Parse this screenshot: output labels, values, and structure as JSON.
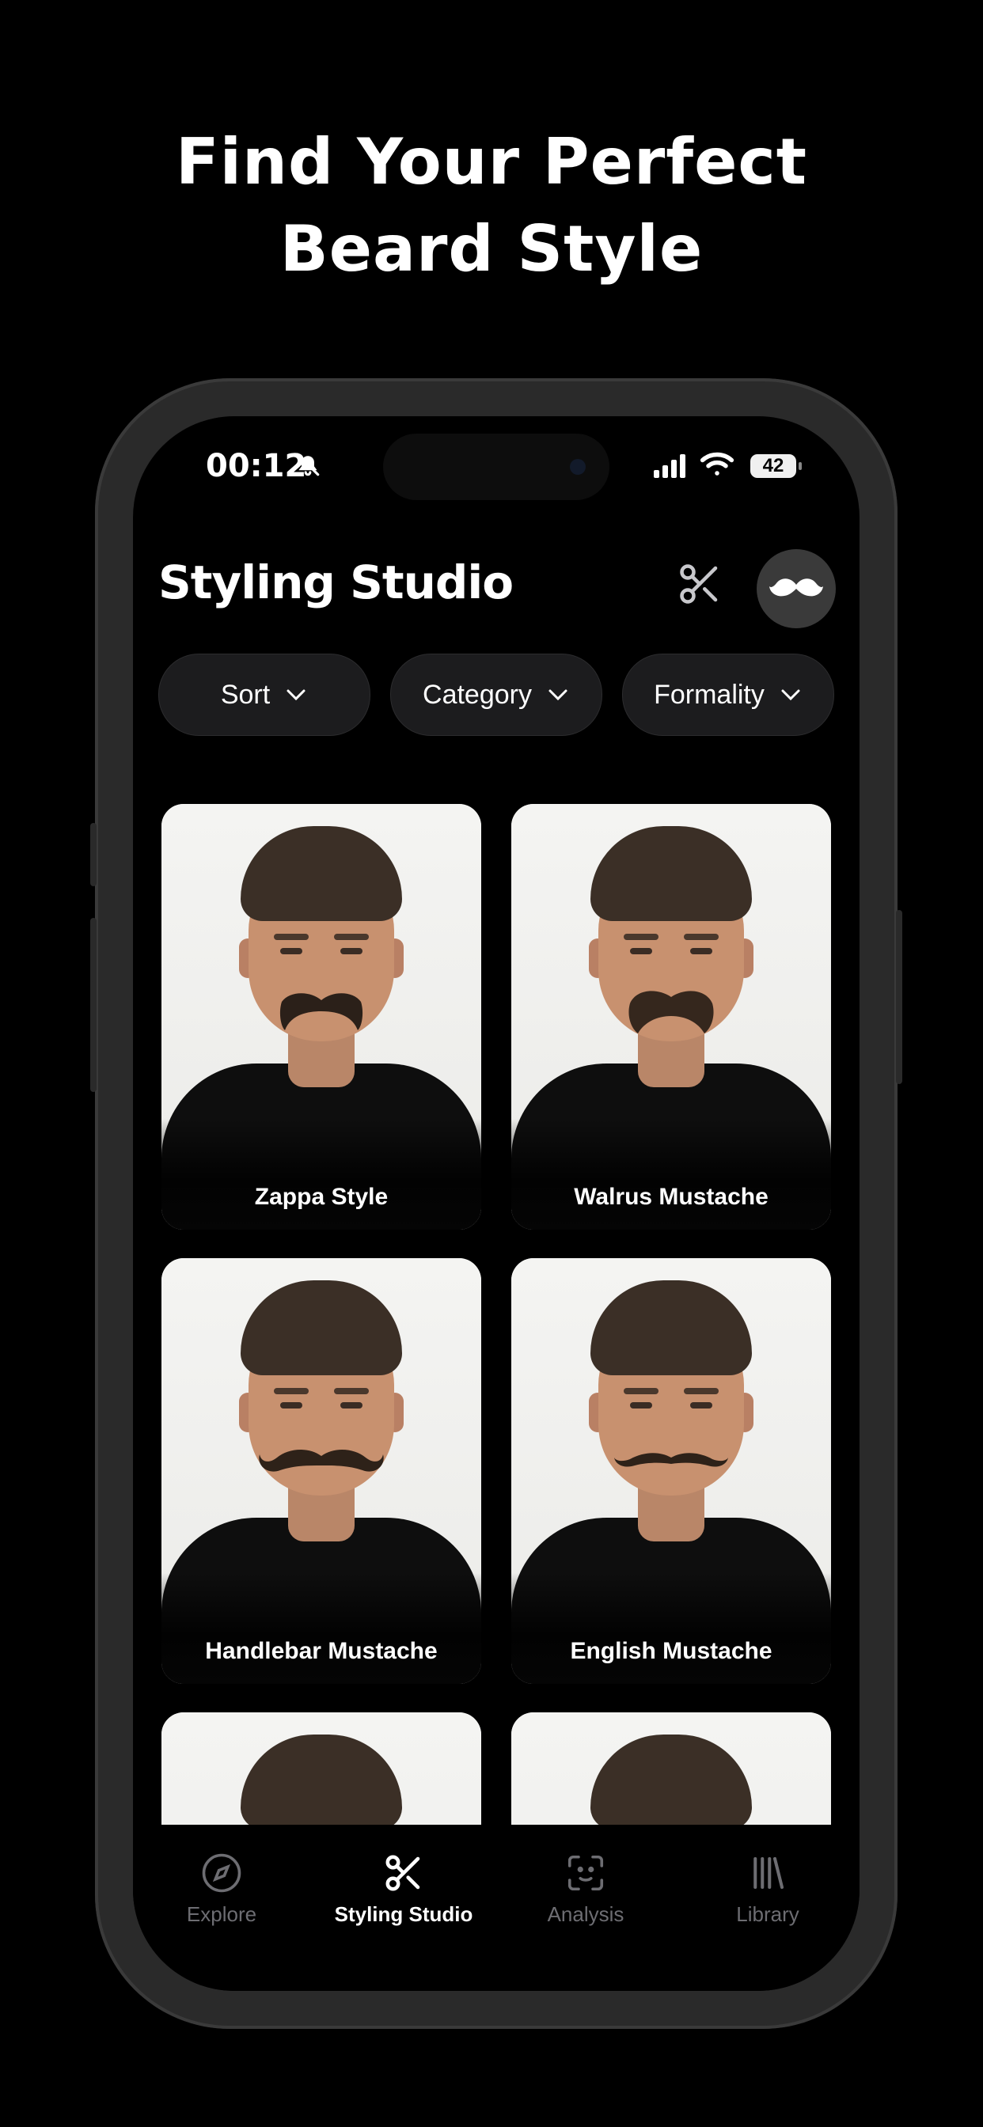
{
  "promo": {
    "headline_line1": "Find Your Perfect",
    "headline_line2": "Beard Style"
  },
  "status_bar": {
    "time": "00:12",
    "battery": "42",
    "icons": [
      "bell-slash-icon",
      "signal-bars-icon",
      "wifi-icon",
      "battery-icon"
    ]
  },
  "header": {
    "title": "Styling Studio",
    "actions": [
      "scissors-icon",
      "mustache-icon"
    ]
  },
  "filters": [
    {
      "label": "Sort"
    },
    {
      "label": "Category"
    },
    {
      "label": "Formality"
    }
  ],
  "styles": [
    {
      "name": "Zappa Style",
      "mustache": "zappa"
    },
    {
      "name": "Walrus Mustache",
      "mustache": "walrus"
    },
    {
      "name": "Handlebar Mustache",
      "mustache": "handlebar"
    },
    {
      "name": "English Mustache",
      "mustache": "english"
    },
    {
      "name": "",
      "mustache": "none"
    },
    {
      "name": "",
      "mustache": "none"
    }
  ],
  "tab_bar": {
    "items": [
      {
        "label": "Explore",
        "icon": "compass-icon",
        "active": false
      },
      {
        "label": "Styling Studio",
        "icon": "scissors-icon",
        "active": true
      },
      {
        "label": "Analysis",
        "icon": "face-scan-icon",
        "active": false
      },
      {
        "label": "Library",
        "icon": "library-icon",
        "active": false
      }
    ]
  },
  "colors": {
    "background": "#000000",
    "chip": "#1c1c1e",
    "inactive_tab": "#6d6d72",
    "active_tab": "#ffffff"
  }
}
